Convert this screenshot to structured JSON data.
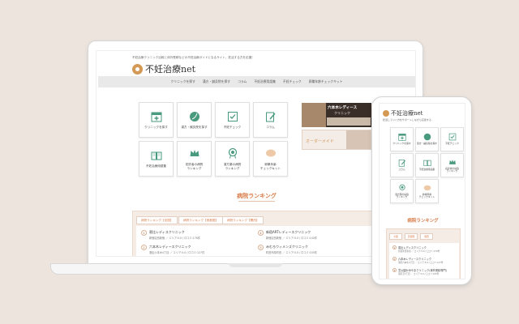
{
  "site": {
    "tagline": "不妊治療クリニック比較と体外受精などの不妊治療ガイドとなるサイト、妊活する方を応援！",
    "logo_text": "不妊治療net",
    "phone_subtitle": "妊活していく方をサポートしながら応援する",
    "accent_color": "#d97c4a",
    "logo_color": "#d49a55"
  },
  "nav": {
    "items": [
      "クリニックを探す",
      "漢方・鍼灸院を探す",
      "コラム",
      "不妊治療用語集",
      "不妊チェック",
      "卵巣年齢チェックキット"
    ]
  },
  "menu_tiles": [
    {
      "label": "クリニックを探す",
      "icon": "hospital-icon"
    },
    {
      "label": "漢方・鍼灸院を探す",
      "icon": "herb-icon"
    },
    {
      "label": "不妊チェック",
      "icon": "checkbox-icon"
    },
    {
      "label": "コラム",
      "icon": "pencil-icon"
    },
    {
      "label": "不妊治療用語集",
      "icon": "book-icon"
    },
    {
      "label": "初診者の病院\nランキング",
      "icon": "crown-icon"
    },
    {
      "label": "漢方薬の病院\nランキング",
      "icon": "medal-icon"
    },
    {
      "label": "卵巣年齢\nチェックキット",
      "icon": "kit-icon"
    }
  ],
  "banners": {
    "banner1_title": "六本木レディース",
    "banner1_sub": "クリニック",
    "banner2_text": "オーダーメイド"
  },
  "ranking": {
    "title": "病院ランキング",
    "tabs": [
      "病院ランキング【全国】",
      "病院ランキング【首都圏】",
      "病院ランキング【関西】"
    ],
    "phone_tabs": [
      "全国",
      "首都圏",
      "関西"
    ],
    "items": [
      {
        "num": "1",
        "name": "恵比レディスクリニック",
        "addr": "新宿区西新宿 ／ エリア:5.0 / 口コミ:176件"
      },
      {
        "num": "2",
        "name": "六本木レディースクリニック",
        "addr": "港区六本木4丁目 ／ エリア:5.0 / 口コミ:127件"
      },
      {
        "num": "4",
        "name": "新宿ARTレディースクリニック",
        "addr": "新宿区西新宿 ／ エリア:5.0 / 口コミ:140件"
      },
      {
        "num": "5",
        "name": "みむろウィメンズクリニック",
        "addr": "町田市原町田 ／ エリア:5.0 / 口コミ:105件"
      }
    ],
    "phone_items": [
      {
        "num": "1",
        "name": "恵比レディスクリニック",
        "addr": "新宿区西新宿 ／ エリア:5.0 / 口コミ:176件"
      },
      {
        "num": "2",
        "name": "六本木レディースクリニック",
        "addr": "港区六本木4丁目 ／ エリア:5.0 / 口コミ:127件"
      },
      {
        "num": "3",
        "name": "芝公園かみやまクリニック(体外受精専門)",
        "addr": "港区芝2丁目 ／ エリア:5.0 / 口コミ:102件"
      }
    ]
  }
}
